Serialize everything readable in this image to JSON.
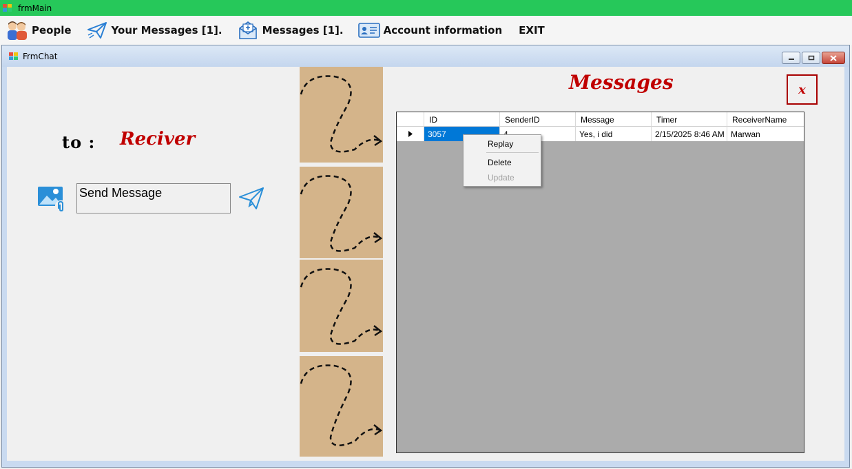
{
  "outer_window": {
    "title": "frmMain"
  },
  "menu": {
    "items": [
      {
        "label": "People",
        "icon": "people-icon"
      },
      {
        "label": "Your Messages [1].",
        "icon": "paper-plane-icon"
      },
      {
        "label": "Messages [1].",
        "icon": "envelope-icon"
      },
      {
        "label": "Account information",
        "icon": "id-card-icon"
      },
      {
        "label": "EXIT"
      }
    ]
  },
  "chat_window": {
    "title": "FrmChat",
    "to_label": "to :",
    "receiver": "Reciver",
    "message_placeholder": "Send Message",
    "messages_title": "Messages",
    "close_label": "x"
  },
  "grid": {
    "columns": [
      "ID",
      "SenderID",
      "Message",
      "Timer",
      "ReceiverName"
    ],
    "rows": [
      {
        "id": "3057",
        "sender": "4",
        "message": "Yes, i did",
        "timer": "2/15/2025 8:46 AM",
        "receiver": "Marwan"
      }
    ]
  },
  "context_menu": {
    "items": [
      "Replay",
      "Delete",
      "Update"
    ],
    "disabled": [
      "Update"
    ]
  },
  "colors": {
    "accent_red": "#c00000",
    "titlebar_green": "#26c85a",
    "selection_blue": "#0078d7",
    "tile_tan": "#d4b48a"
  }
}
